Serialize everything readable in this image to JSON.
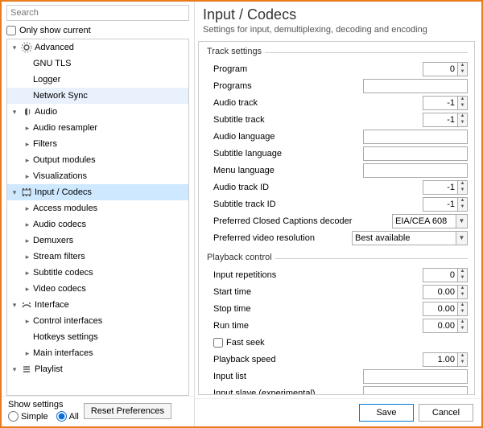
{
  "search": {
    "placeholder": "Search"
  },
  "onlyCurrentLabel": "Only show current",
  "tree": [
    {
      "label": "Advanced",
      "depth": 0,
      "twisty": "down",
      "icon": "gear-icon"
    },
    {
      "label": "GNU TLS",
      "depth": 1,
      "twisty": "none"
    },
    {
      "label": "Logger",
      "depth": 1,
      "twisty": "none"
    },
    {
      "label": "Network Sync",
      "depth": 1,
      "twisty": "none",
      "hover": true
    },
    {
      "label": "Audio",
      "depth": 0,
      "twisty": "down",
      "icon": "audio-icon"
    },
    {
      "label": "Audio resampler",
      "depth": 1,
      "twisty": "right"
    },
    {
      "label": "Filters",
      "depth": 1,
      "twisty": "right"
    },
    {
      "label": "Output modules",
      "depth": 1,
      "twisty": "right"
    },
    {
      "label": "Visualizations",
      "depth": 1,
      "twisty": "right"
    },
    {
      "label": "Input / Codecs",
      "depth": 0,
      "twisty": "down",
      "icon": "codec-icon",
      "selected": true
    },
    {
      "label": "Access modules",
      "depth": 1,
      "twisty": "right"
    },
    {
      "label": "Audio codecs",
      "depth": 1,
      "twisty": "right"
    },
    {
      "label": "Demuxers",
      "depth": 1,
      "twisty": "right"
    },
    {
      "label": "Stream filters",
      "depth": 1,
      "twisty": "right"
    },
    {
      "label": "Subtitle codecs",
      "depth": 1,
      "twisty": "right"
    },
    {
      "label": "Video codecs",
      "depth": 1,
      "twisty": "right"
    },
    {
      "label": "Interface",
      "depth": 0,
      "twisty": "down",
      "icon": "interface-icon"
    },
    {
      "label": "Control interfaces",
      "depth": 1,
      "twisty": "right"
    },
    {
      "label": "Hotkeys settings",
      "depth": 1,
      "twisty": "none"
    },
    {
      "label": "Main interfaces",
      "depth": 1,
      "twisty": "right"
    },
    {
      "label": "Playlist",
      "depth": 0,
      "twisty": "down",
      "icon": "playlist-icon"
    }
  ],
  "showSettings": {
    "title": "Show settings",
    "simpleLabel": "Simple",
    "allLabel": "All",
    "resetLabel": "Reset Preferences"
  },
  "right": {
    "title": "Input / Codecs",
    "subtitle": "Settings for input, demultiplexing, decoding and encoding",
    "groups": [
      {
        "title": "Track settings",
        "fields": [
          {
            "label": "Program",
            "type": "spin",
            "value": "0"
          },
          {
            "label": "Programs",
            "type": "text",
            "value": ""
          },
          {
            "label": "Audio track",
            "type": "spin",
            "value": "-1"
          },
          {
            "label": "Subtitle track",
            "type": "spin",
            "value": "-1"
          },
          {
            "label": "Audio language",
            "type": "text",
            "value": ""
          },
          {
            "label": "Subtitle language",
            "type": "text",
            "value": ""
          },
          {
            "label": "Menu language",
            "type": "text",
            "value": ""
          },
          {
            "label": "Audio track ID",
            "type": "spin",
            "value": "-1"
          },
          {
            "label": "Subtitle track ID",
            "type": "spin",
            "value": "-1"
          },
          {
            "label": "Preferred Closed Captions decoder",
            "type": "combo",
            "value": "EIA/CEA 608",
            "w": "w80"
          },
          {
            "label": "Preferred video resolution",
            "type": "combo",
            "value": "Best available",
            "w": "w130"
          }
        ]
      },
      {
        "title": "Playback control",
        "fields": [
          {
            "label": "Input repetitions",
            "type": "spin",
            "value": "0"
          },
          {
            "label": "Start time",
            "type": "spin",
            "value": "0.00"
          },
          {
            "label": "Stop time",
            "type": "spin",
            "value": "0.00"
          },
          {
            "label": "Run time",
            "type": "spin",
            "value": "0.00"
          },
          {
            "label": "Fast seek",
            "type": "check",
            "checked": false
          },
          {
            "label": "Playback speed",
            "type": "spin",
            "value": "1.00"
          },
          {
            "label": "Input list",
            "type": "text",
            "value": ""
          },
          {
            "label": "Input slave (experimental)",
            "type": "text",
            "value": ""
          }
        ]
      }
    ]
  },
  "buttons": {
    "save": "Save",
    "cancel": "Cancel"
  }
}
